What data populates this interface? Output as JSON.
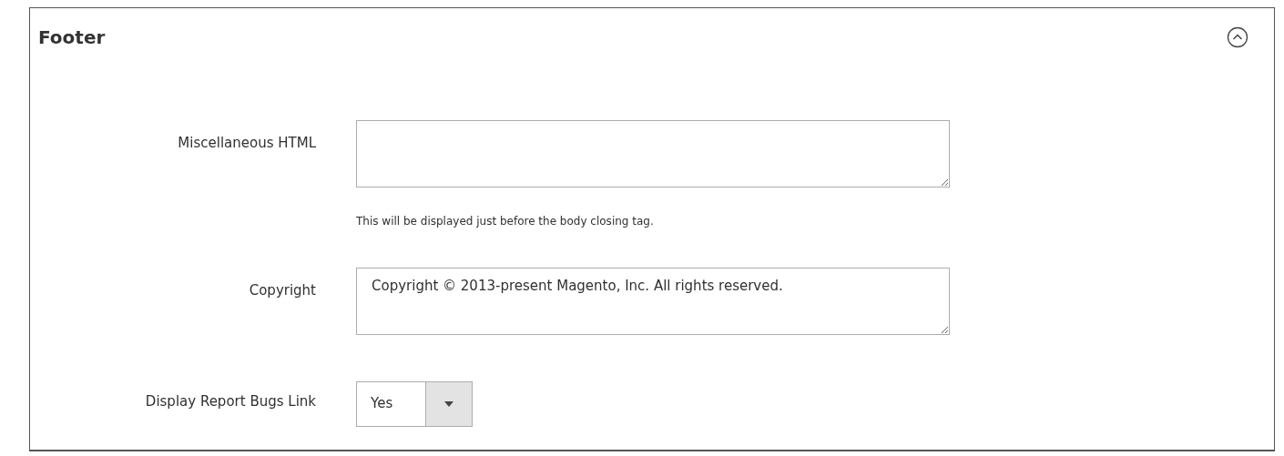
{
  "section": {
    "title": "Footer",
    "expanded": true
  },
  "fields": [
    {
      "kind": "textarea",
      "label": "Miscellaneous HTML",
      "note": "This will be displayed just before the body closing tag."
    },
    {
      "kind": "textarea",
      "label": "Copyright",
      "value": "Copyright © 2013-present Magento, Inc. All rights reserved."
    },
    {
      "kind": "select",
      "label": "Display Report Bugs Link",
      "value": "Yes"
    }
  ]
}
